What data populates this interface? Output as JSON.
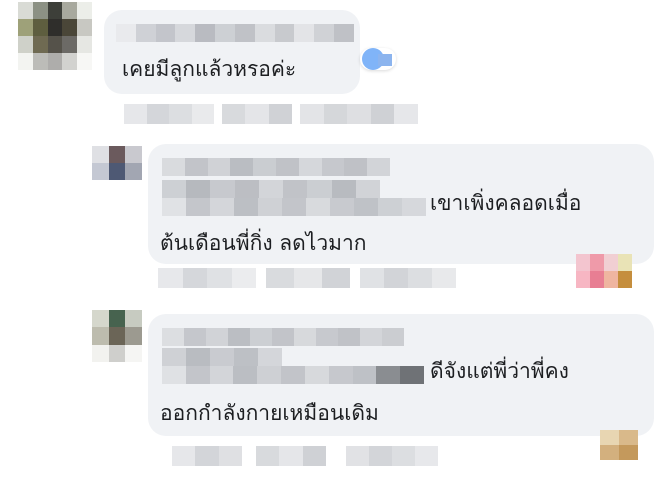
{
  "comments": [
    {
      "level": "top",
      "author_name_redacted": true,
      "text": "เคยมีลูกแล้วหรอค่ะ",
      "reaction_icons": [
        "like-icon"
      ]
    },
    {
      "level": "reply",
      "author_name_redacted": true,
      "text_line1": "เขาเพิ่งคลอดเมื่อ",
      "text_line2": "ต้นเดือนพี่กิ่ง ลดไวมาก",
      "reaction_icons": [
        "love-icon",
        "haha-icon"
      ]
    },
    {
      "level": "reply",
      "author_name_redacted": true,
      "text_line1": "ดีจังแต่พี่ว่าพี่คง",
      "text_line2": "ออกกำลังกายเหมือนเดิม",
      "reaction_icons": [
        "haha-icon"
      ]
    }
  ],
  "colors": {
    "bubble_bg": "#f0f2f5",
    "text": "#1c1e21",
    "redaction_light": "#e4e6ea",
    "redaction_dark": "#8a8d91"
  }
}
